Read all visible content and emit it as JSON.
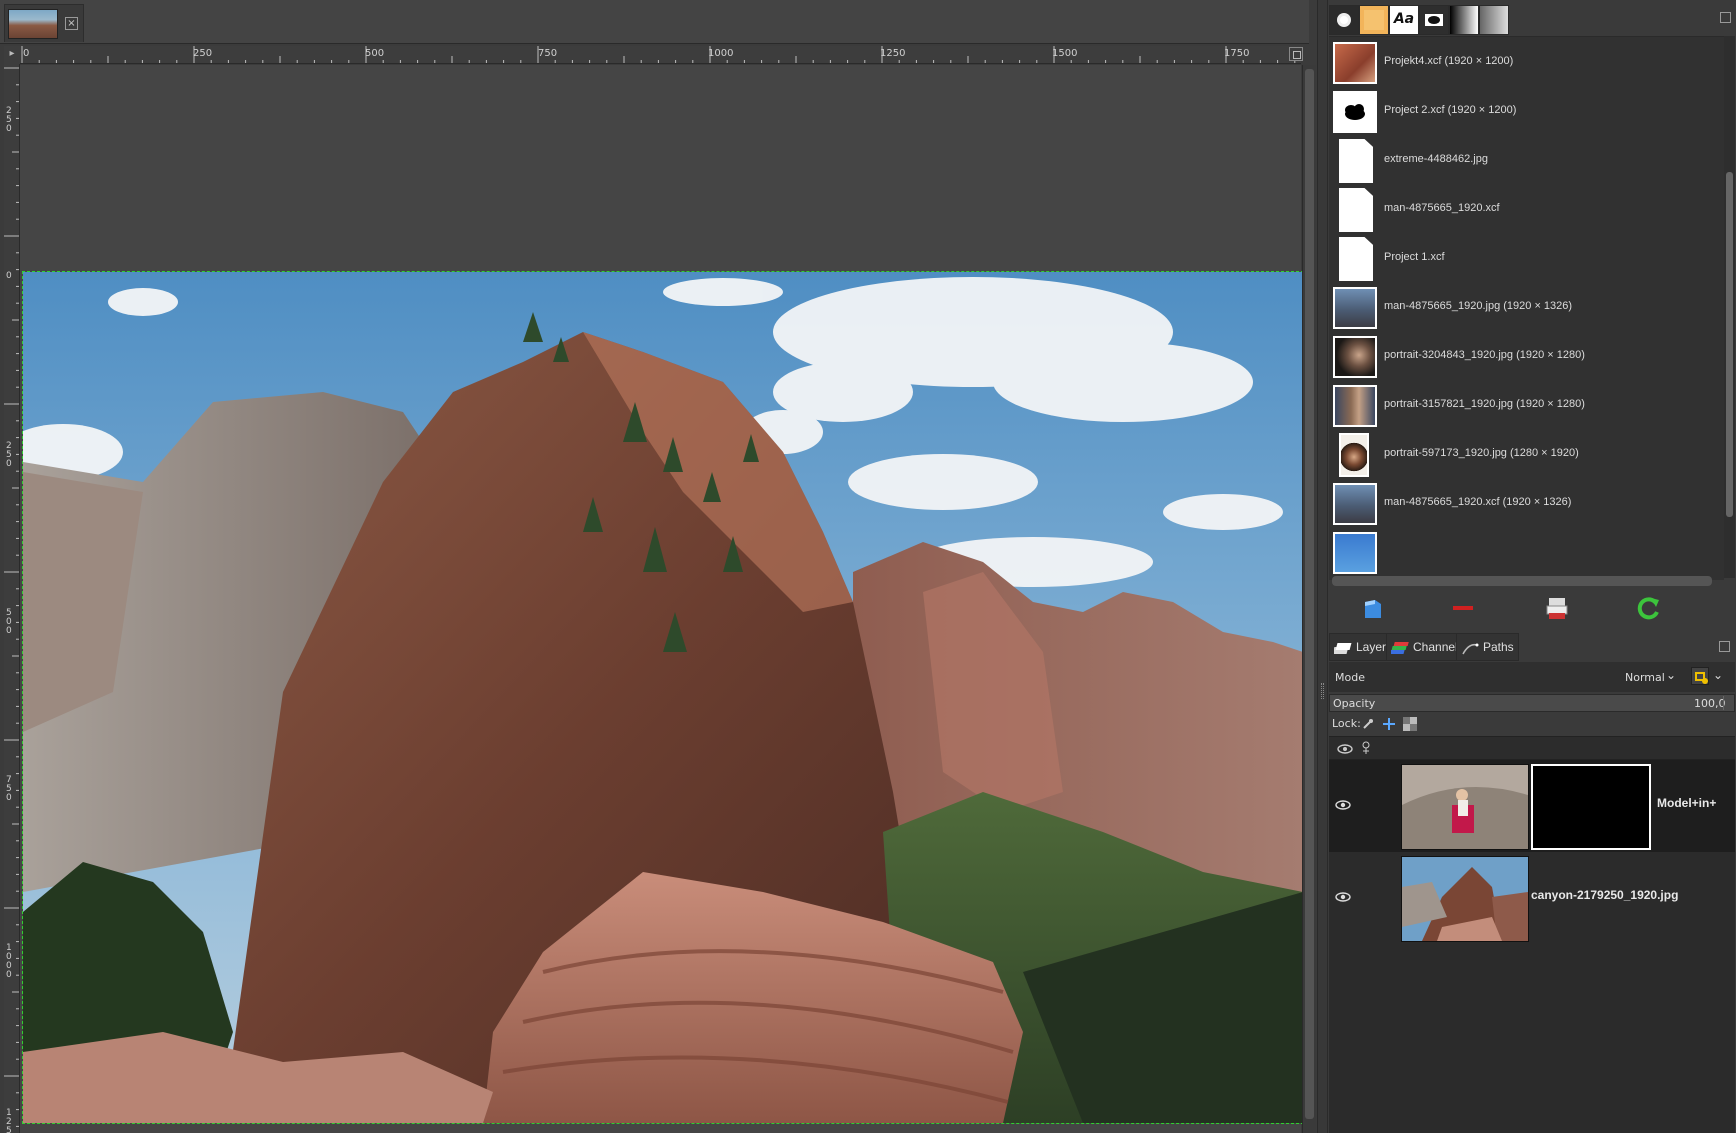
{
  "image_tab": {
    "close_label": "×"
  },
  "rulers": {
    "corner_label": "▸",
    "horizontal_labels": [
      "0",
      "250",
      "500",
      "750",
      "1000",
      "1250",
      "1500",
      "1750"
    ],
    "vertical_labels": [
      "250",
      "0",
      "250",
      "500",
      "750",
      "1000",
      "125"
    ]
  },
  "dock_top_tabs": [
    {
      "icon": "brush-icon"
    },
    {
      "icon": "pattern-icon"
    },
    {
      "icon": "font-icon",
      "label": "Aa"
    },
    {
      "icon": "image-mask-icon"
    },
    {
      "icon": "gradient-icon"
    },
    {
      "icon": "gray-gradient-icon"
    }
  ],
  "history": {
    "items": [
      {
        "label": "Projekt4.xcf (1920 × 1200)",
        "thumb": "photo-red"
      },
      {
        "label": "Project 2.xcf (1920 × 1200)",
        "thumb": "cloud"
      },
      {
        "label": "extreme-4488462.jpg",
        "thumb": "doc"
      },
      {
        "label": "man-4875665_1920.xcf",
        "thumb": "doc"
      },
      {
        "label": "Project 1.xcf",
        "thumb": "doc"
      },
      {
        "label": "man-4875665_1920.jpg (1920 × 1326)",
        "thumb": "photo-blue"
      },
      {
        "label": "portrait-3204843_1920.jpg (1920 × 1280)",
        "thumb": "photo-dark"
      },
      {
        "label": "portrait-3157821_1920.jpg (1920 × 1280)",
        "thumb": "photo-skin"
      },
      {
        "label": "portrait-597173_1920.jpg (1280 × 1920)",
        "thumb": "photo-hat"
      },
      {
        "label": "man-4875665_1920.xcf (1920 × 1326)",
        "thumb": "photo-blue"
      }
    ]
  },
  "history_buttons": [
    "open-icon",
    "remove-icon",
    "clear-icon",
    "refresh-icon"
  ],
  "layer_tabs": [
    {
      "label": "Layers",
      "icon": "layers-tab-icon"
    },
    {
      "label": "Channels",
      "icon": "channels-tab-icon"
    },
    {
      "label": "Paths",
      "icon": "paths-tab-icon"
    }
  ],
  "layers_panel": {
    "mode_label": "Mode",
    "mode_value": "Normal",
    "opacity_label": "Opacity",
    "opacity_value": "100,0",
    "lock_label": "Lock:",
    "layers": [
      {
        "name": "Model+in+",
        "visible": true,
        "has_mask": true
      },
      {
        "name": "canyon-2179250_1920.jpg",
        "visible": true,
        "has_mask": false
      }
    ]
  },
  "colors": {
    "selection_border": "#2fd12f",
    "panel_bg": "#3a3a3a",
    "canvas_bg": "#454545",
    "refresh_green": "#3cc43c",
    "remove_red": "#d02020"
  }
}
